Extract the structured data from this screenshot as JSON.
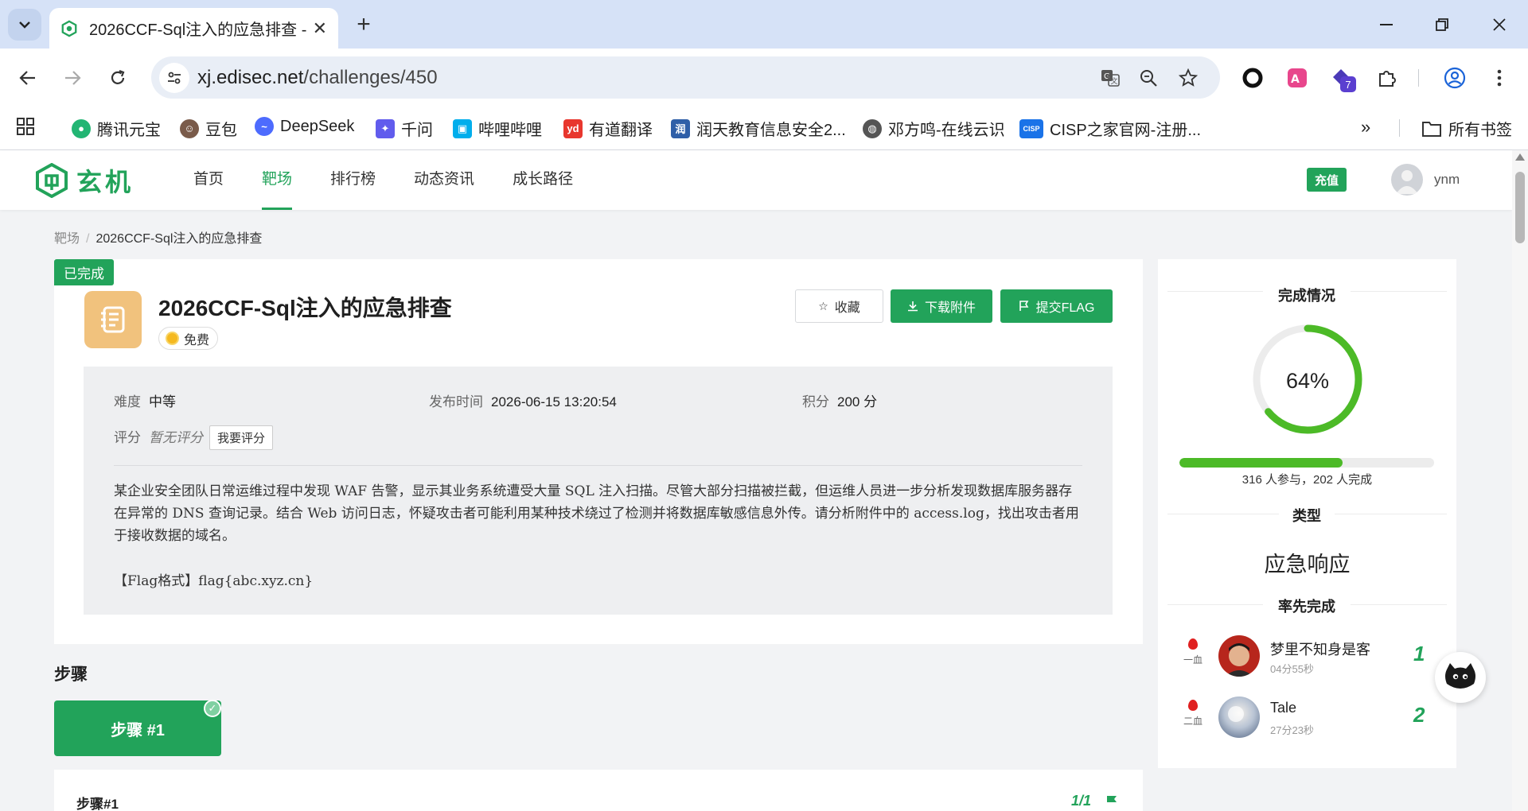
{
  "browser": {
    "tab_title": "2026CCF-Sql注入的应急排查 -",
    "url_host": "xj.edisec.net",
    "url_path": "/challenges/450",
    "extension_badge": "7",
    "bookmarks": [
      {
        "label": "腾讯元宝",
        "icon": "yuanbao-icon",
        "color": "#22b573"
      },
      {
        "label": "豆包",
        "icon": "doubao-icon",
        "color": "#7a5b4a"
      },
      {
        "label": "DeepSeek",
        "icon": "deepseek-icon",
        "color": "#4d6bfe"
      },
      {
        "label": "千问",
        "icon": "qianwen-icon",
        "color": "#615ced"
      },
      {
        "label": "哔哩哔哩",
        "icon": "bilibili-icon",
        "color": "#00aeec"
      },
      {
        "label": "有道翻译",
        "icon": "youdao-icon",
        "color": "#e8372e"
      },
      {
        "label": "润天教育信息安全2...",
        "icon": "runtian-icon",
        "color": "#2f5fa8"
      },
      {
        "label": "邓方鸣-在线云识",
        "icon": "globe-icon",
        "color": "#555555"
      },
      {
        "label": "CISP之家官网-注册...",
        "icon": "cisp-icon",
        "color": "#1a73e8"
      }
    ],
    "all_bookmarks": "所有书签"
  },
  "site": {
    "logo_text": "玄机",
    "nav": [
      "首页",
      "靶场",
      "排行榜",
      "动态资讯",
      "成长路径"
    ],
    "recharge": "充值",
    "username": "ynm",
    "accent": "#22a35a"
  },
  "breadcrumb": {
    "root": "靶场",
    "separator": "/",
    "current": "2026CCF-Sql注入的应急排查"
  },
  "challenge": {
    "status_badge": "已完成",
    "title": "2026CCF-Sql注入的应急排查",
    "price": "免费",
    "buttons": {
      "favorite": "收藏",
      "download": "下载附件",
      "submit": "提交FLAG"
    },
    "difficulty_label": "难度",
    "difficulty": "中等",
    "publish_label": "发布时间",
    "publish_time": "2026-06-15 13:20:54",
    "score_label": "积分",
    "score": "200 分",
    "rating_label": "评分",
    "rating": "暂无评分",
    "rate_button": "我要评分",
    "description": "某企业安全团队日常运维过程中发现 WAF 告警，显示其业务系统遭受大量 SQL 注入扫描。尽管大部分扫描被拦截，但运维人员进一步分析发现数据库服务器存在异常的 DNS 查询记录。结合 Web 访问日志，怀疑攻击者可能利用某种技术绕过了检测并将数据库敏感信息外传。请分析附件中的 access.log，找出攻击者用于接收数据的域名。",
    "flag_format": "【Flag格式】flag{abc.xyz.cn}"
  },
  "steps": {
    "title": "步骤",
    "tab_label": "步骤 #1",
    "card_title": "步骤#1",
    "progress": "1/1"
  },
  "sidebar": {
    "completion_title": "完成情况",
    "completion_percent": 64,
    "completion_label": "64%",
    "participants_text": "316 人参与，202 人完成",
    "category_title": "类型",
    "category": "应急响应",
    "first_blood_title": "率先完成",
    "solvers": [
      {
        "blood": "一血",
        "name": "梦里不知身是客",
        "time": "04分55秒",
        "rank": "1"
      },
      {
        "blood": "二血",
        "name": "Tale",
        "time": "27分23秒",
        "rank": "2"
      }
    ]
  }
}
